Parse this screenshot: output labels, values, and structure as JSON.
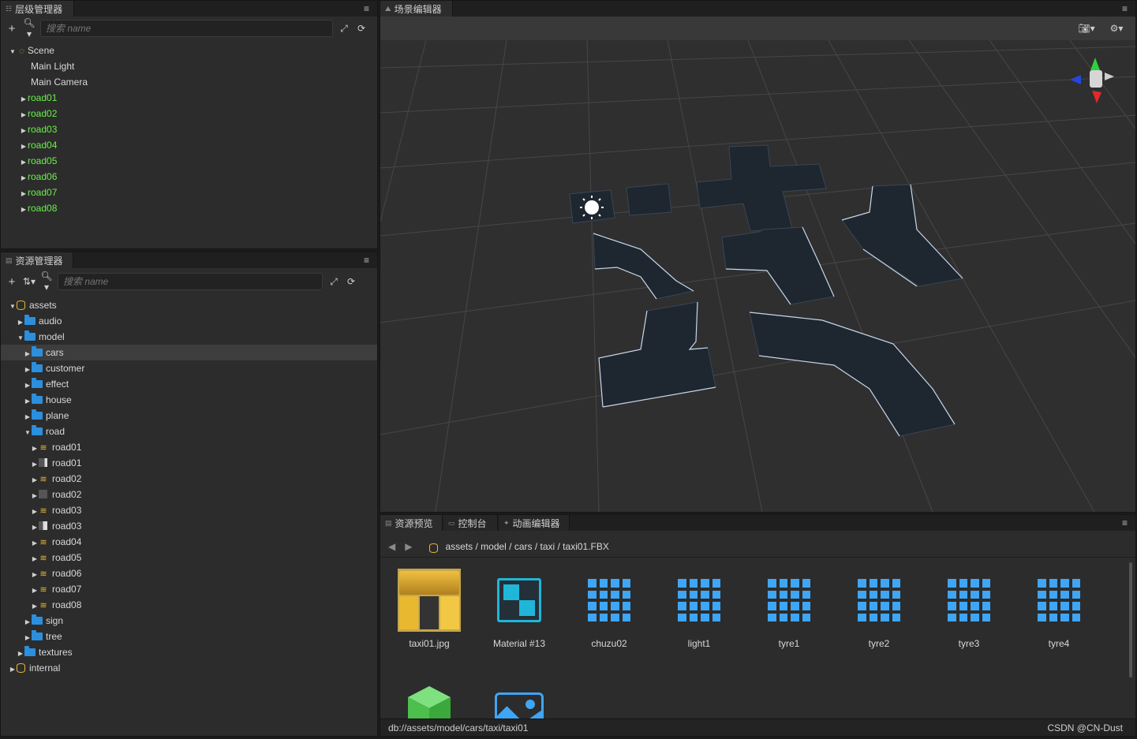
{
  "hierarchy": {
    "title": "层级管理器",
    "search_placeholder": "搜索 name",
    "nodes": [
      {
        "label": "Scene"
      },
      {
        "label": "Main Light"
      },
      {
        "label": "Main Camera"
      },
      {
        "label": "road01"
      },
      {
        "label": "road02"
      },
      {
        "label": "road03"
      },
      {
        "label": "road04"
      },
      {
        "label": "road05"
      },
      {
        "label": "road06"
      },
      {
        "label": "road07"
      },
      {
        "label": "road08"
      }
    ]
  },
  "assets": {
    "title": "资源管理器",
    "search_placeholder": "搜索 name",
    "items": [
      {
        "label": "assets"
      },
      {
        "label": "audio"
      },
      {
        "label": "model"
      },
      {
        "label": "cars"
      },
      {
        "label": "customer"
      },
      {
        "label": "effect"
      },
      {
        "label": "house"
      },
      {
        "label": "plane"
      },
      {
        "label": "road"
      },
      {
        "label": "road01"
      },
      {
        "label": "road01"
      },
      {
        "label": "road02"
      },
      {
        "label": "road02"
      },
      {
        "label": "road03"
      },
      {
        "label": "road03"
      },
      {
        "label": "road04"
      },
      {
        "label": "road05"
      },
      {
        "label": "road06"
      },
      {
        "label": "road07"
      },
      {
        "label": "road08"
      },
      {
        "label": "sign"
      },
      {
        "label": "tree"
      },
      {
        "label": "textures"
      },
      {
        "label": "internal"
      }
    ]
  },
  "scene_editor": {
    "title": "场景编辑器"
  },
  "bottom": {
    "tabs": [
      {
        "label": "资源预览"
      },
      {
        "label": "控制台"
      },
      {
        "label": "动画编辑器"
      }
    ],
    "path": "assets / model / cars / taxi / taxi01.FBX",
    "assets": [
      {
        "name": "taxi01.jpg"
      },
      {
        "name": "Material #13"
      },
      {
        "name": "chuzu02"
      },
      {
        "name": "light1"
      },
      {
        "name": "tyre1"
      },
      {
        "name": "tyre2"
      },
      {
        "name": "tyre3"
      },
      {
        "name": "tyre4"
      }
    ],
    "status_path": "db://assets/model/cars/taxi/taxi01",
    "watermark": "CSDN @CN-Dust"
  },
  "colors": {
    "panel_bg": "#2c2c2c",
    "scene_bg": "#2f2f2f",
    "node_green": "#6cf04c",
    "folder_blue": "#2b8fde",
    "accent_blue": "#3fa5f5",
    "db_yellow": "#e8b831"
  }
}
